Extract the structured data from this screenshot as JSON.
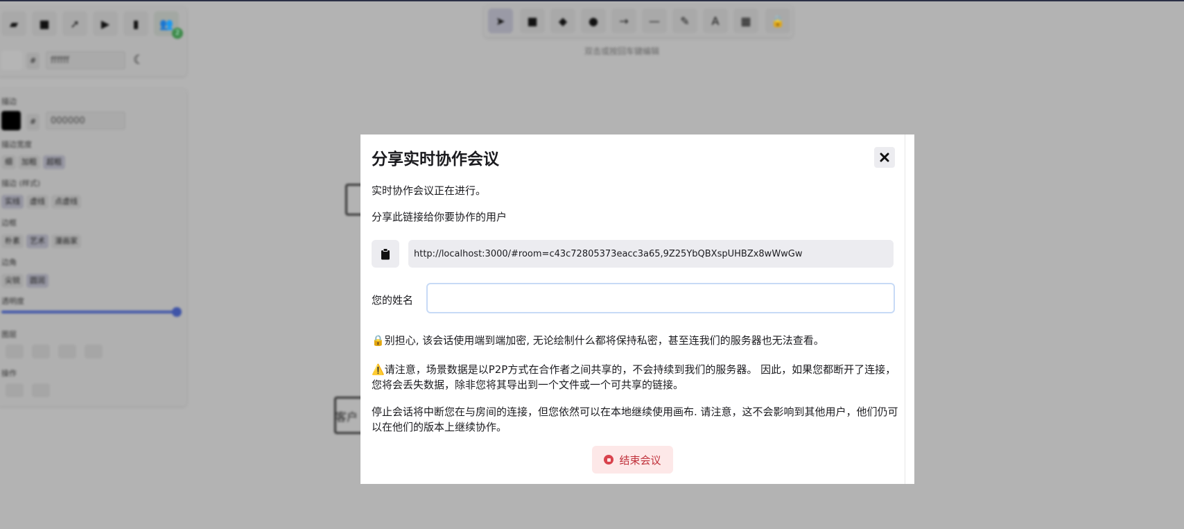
{
  "background": {
    "color_hex": "#000000",
    "color_value": "000000",
    "bg_color_value": "ffffff",
    "hint_text": "双击或按回车键编辑",
    "participant_count": "2",
    "labels": {
      "stroke": "描边",
      "stroke_width": "描边宽度",
      "stroke_style": "描边 (样式)",
      "sloppiness": "边框",
      "edges": "边角",
      "opacity": "透明度",
      "layers": "图层",
      "actions": "操作"
    },
    "stroke_width_options": [
      "细",
      "加粗",
      "超粗"
    ],
    "stroke_style_options": [
      "实线",
      "虚线",
      "点虚线"
    ],
    "sloppiness_options": [
      "朴素",
      "艺术",
      "漫画家"
    ],
    "edge_options": [
      "尖锐",
      "圆润"
    ],
    "canvas_text_1": "客户"
  },
  "modal": {
    "title": "分享实时协作会议",
    "status_text": "实时协作会议正在进行。",
    "share_text": "分享此链接给你要协作的用户",
    "link_value": "http://localhost:3000/#room=c43c72805373eacc3a65,9Z25YbQBXspUHBZx8wWwGw",
    "name_label": "您的姓名",
    "name_value": "",
    "privacy_text": "别担心, 该会话使用端到端加密, 无论绘制什么都将保持私密，甚至连我们的服务器也无法查看。",
    "warning_text": "请注意，场景数据是以P2P方式在合作者之间共享的，不会持续到我们的服务器。 因此，如果您都断开了连接，您将会丢失数据，除非您将其导出到一个文件或一个可共享的链接。",
    "stop_info_text": "停止会话将中断您在与房间的连接，但您依然可以在本地继续使用画布. 请注意，这不会影响到其他用户，他们仍可以在他们的版本上继续协作。",
    "stop_button_label": "结束会议",
    "lock_emoji": "🔒",
    "warning_emoji": "⚠️"
  }
}
